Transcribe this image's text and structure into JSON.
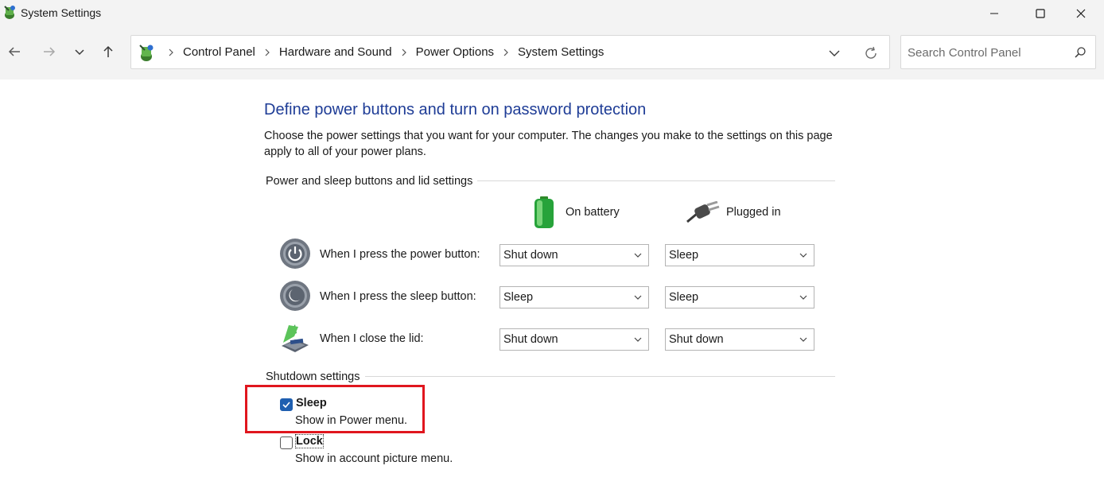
{
  "window": {
    "title": "System Settings",
    "app_icon": "control-panel-icon"
  },
  "nav": {
    "back_icon": "back-arrow-icon",
    "forward_icon": "forward-arrow-icon",
    "recent_icon": "chevron-down-icon",
    "up_icon": "up-arrow-icon"
  },
  "breadcrumb": {
    "items": [
      "Control Panel",
      "Hardware and Sound",
      "Power Options",
      "System Settings"
    ]
  },
  "search": {
    "placeholder": "Search Control Panel"
  },
  "page": {
    "title": "Define power buttons and turn on password protection",
    "description": "Choose the power settings that you want for your computer. The changes you make to the settings on this page apply to all of your power plans."
  },
  "power_section": {
    "header": "Power and sleep buttons and lid settings",
    "col_battery": "On battery",
    "col_plugged": "Plugged in",
    "rows": [
      {
        "label": "When I press the power button:",
        "battery": "Shut down",
        "plugged": "Sleep"
      },
      {
        "label": "When I press the sleep button:",
        "battery": "Sleep",
        "plugged": "Sleep"
      },
      {
        "label": "When I close the lid:",
        "battery": "Shut down",
        "plugged": "Shut down"
      }
    ]
  },
  "shutdown_section": {
    "header": "Shutdown settings",
    "items": [
      {
        "label": "Sleep",
        "desc": "Show in Power menu.",
        "checked": true
      },
      {
        "label": "Lock",
        "desc": "Show in account picture menu.",
        "checked": false
      }
    ]
  },
  "colors": {
    "title_blue": "#1e3c96",
    "highlight_red": "#e0161e",
    "checkbox_blue": "#1f5fb0"
  }
}
